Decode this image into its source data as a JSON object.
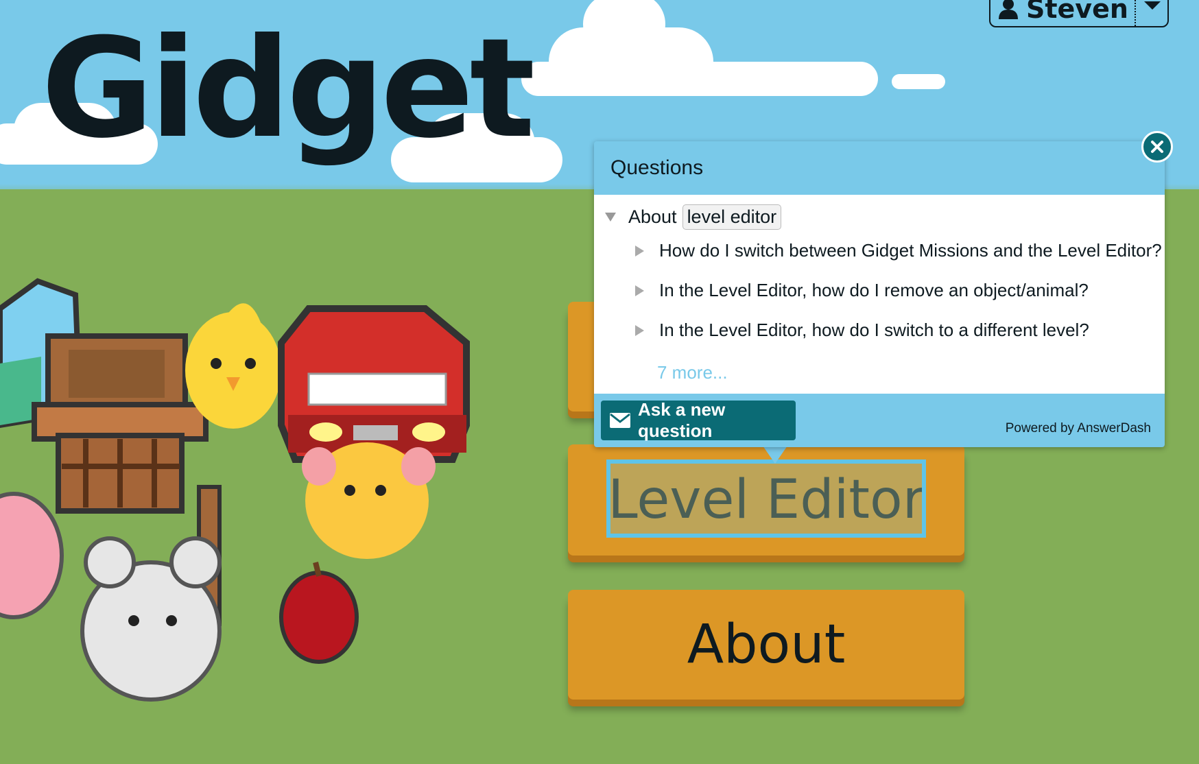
{
  "app": {
    "logo_text": "Gidget"
  },
  "user_menu": {
    "name": "Steven",
    "icons": [
      "user-icon",
      "caret-down-icon"
    ]
  },
  "menu": {
    "buttons": [
      {
        "label": ""
      },
      {
        "label": "Level Editor"
      },
      {
        "label": "About"
      }
    ]
  },
  "help_popup": {
    "title": "Questions",
    "about_prefix": "About",
    "topic_tag": "level editor",
    "questions": [
      "How do I switch between Gidget Missions and the Level Editor?",
      "In the Level Editor, how do I remove an object/animal?",
      "In the Level Editor, how do I switch to a different level?"
    ],
    "more_link": "7 more...",
    "ask_button": "Ask a new question",
    "powered_by": "Powered by AnswerDash",
    "icons": [
      "close-icon",
      "mail-icon",
      "triangle-down-icon",
      "triangle-right-icon"
    ]
  },
  "colors": {
    "sky": "#79c9e9",
    "grass": "#83ae57",
    "button": "#dc9726",
    "popup_accent": "#0b6b75",
    "link": "#79c9e9"
  }
}
